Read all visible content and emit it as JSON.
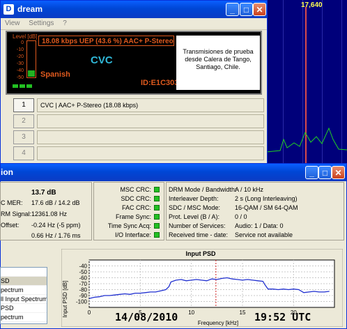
{
  "bg_spectrum": {
    "freq_label": "17,640"
  },
  "dream_window": {
    "title": "dream",
    "menu": [
      "View",
      "Settings",
      "?"
    ],
    "level_title": "Level [dB]",
    "level_ticks": [
      "0",
      "-10",
      "-20",
      "-30",
      "-40",
      "-50"
    ],
    "level_fraction": 0.18,
    "bitrate_text": "18.08 kbps UEP (43.6 %) AAC+ P-Stereo",
    "language": "Spanish",
    "station": "CVC",
    "service_id": "ID:E1C303",
    "text_message": "Transmisiones de prueba desde Calera de Tango, Santiago, Chile.",
    "services": [
      {
        "num": "1",
        "label": "CVC  |  AAC+ P-Stereo (18.08 kbps)"
      },
      {
        "num": "2",
        "label": ""
      },
      {
        "num": "3",
        "label": ""
      },
      {
        "num": "4",
        "label": ""
      }
    ]
  },
  "eval_window": {
    "title_fragment": "ion",
    "snr_value": "13.7 dB",
    "left_labels": [
      "C MER:",
      "RM Signal:",
      "Offset:"
    ],
    "left_values": [
      "17.6 dB / 14.2 dB",
      "12361.08 Hz",
      "-0.24 Hz (-5 ppm)",
      "0.66 Hz / 1.76 ms"
    ],
    "crc_labels": [
      "MSC CRC:",
      "SDC CRC:",
      "FAC CRC:",
      "Frame Sync:",
      "Time Sync Acq:",
      "I/O Interface:"
    ],
    "info": [
      {
        "label": "DRM Mode / Bandwidth:",
        "value": "A / 10 kHz"
      },
      {
        "label": "Interleaver Depth:",
        "value": "2 s (Long Interleaving)"
      },
      {
        "label": "SDC / MSC Mode:",
        "value": "16-QAM / SM 64-QAM"
      },
      {
        "label": "Prot. Level (B / A):",
        "value": "0 / 0"
      },
      {
        "label": "Number of Services:",
        "value": "Audio: 1 / Data: 0"
      },
      {
        "label": "Received time - date:",
        "value": "Service not available"
      }
    ],
    "chart_list": [
      "",
      "SD",
      "pectrum",
      "ll Input Spectrum",
      "PSD",
      "pectrum",
      "pectrum"
    ],
    "date_stamp": "14/08/2010",
    "time_stamp": "19:52 UTC"
  },
  "chart_data": {
    "type": "line",
    "title": "Input PSD",
    "xlabel": "Frequency [kHz]",
    "ylabel": "Input PSD [dB]",
    "xlim": [
      0,
      24
    ],
    "ylim": [
      -110,
      -30
    ],
    "x_ticks": [
      "0",
      "5",
      "10",
      "15",
      "20"
    ],
    "y_ticks": [
      "-40",
      "-50",
      "-60",
      "-70",
      "-80",
      "-90",
      "-100"
    ],
    "series": [
      {
        "color": "#1f2fd0",
        "x": [
          0,
          0.5,
          1,
          1.5,
          2,
          2.5,
          3,
          3.5,
          4,
          4.5,
          5,
          5.5,
          6,
          6.5,
          7,
          7.5,
          7.8,
          8,
          8.5,
          9,
          9.5,
          10,
          10.5,
          11,
          11.5,
          12,
          12.5,
          13,
          13.5,
          14,
          14.5,
          15,
          15.5,
          16,
          16.5,
          17,
          17.2,
          17.5,
          18,
          18.5,
          19,
          19.5,
          20,
          20.5,
          21,
          21.5,
          22,
          22.5,
          23,
          23.5
        ],
        "y": [
          -95,
          -93,
          -92,
          -90,
          -90,
          -89,
          -88,
          -87,
          -88,
          -86,
          -86,
          -85,
          -84,
          -84,
          -82,
          -80,
          -75,
          -67,
          -64,
          -63,
          -65,
          -64,
          -63,
          -64,
          -65,
          -62,
          -63,
          -61,
          -60,
          -62,
          -63,
          -64,
          -63,
          -64,
          -65,
          -66,
          -72,
          -79,
          -79,
          -80,
          -79,
          -80,
          -79,
          -80,
          -85,
          -84,
          -83,
          -84,
          -84,
          -83
        ]
      }
    ],
    "marker_x": 12.4
  }
}
